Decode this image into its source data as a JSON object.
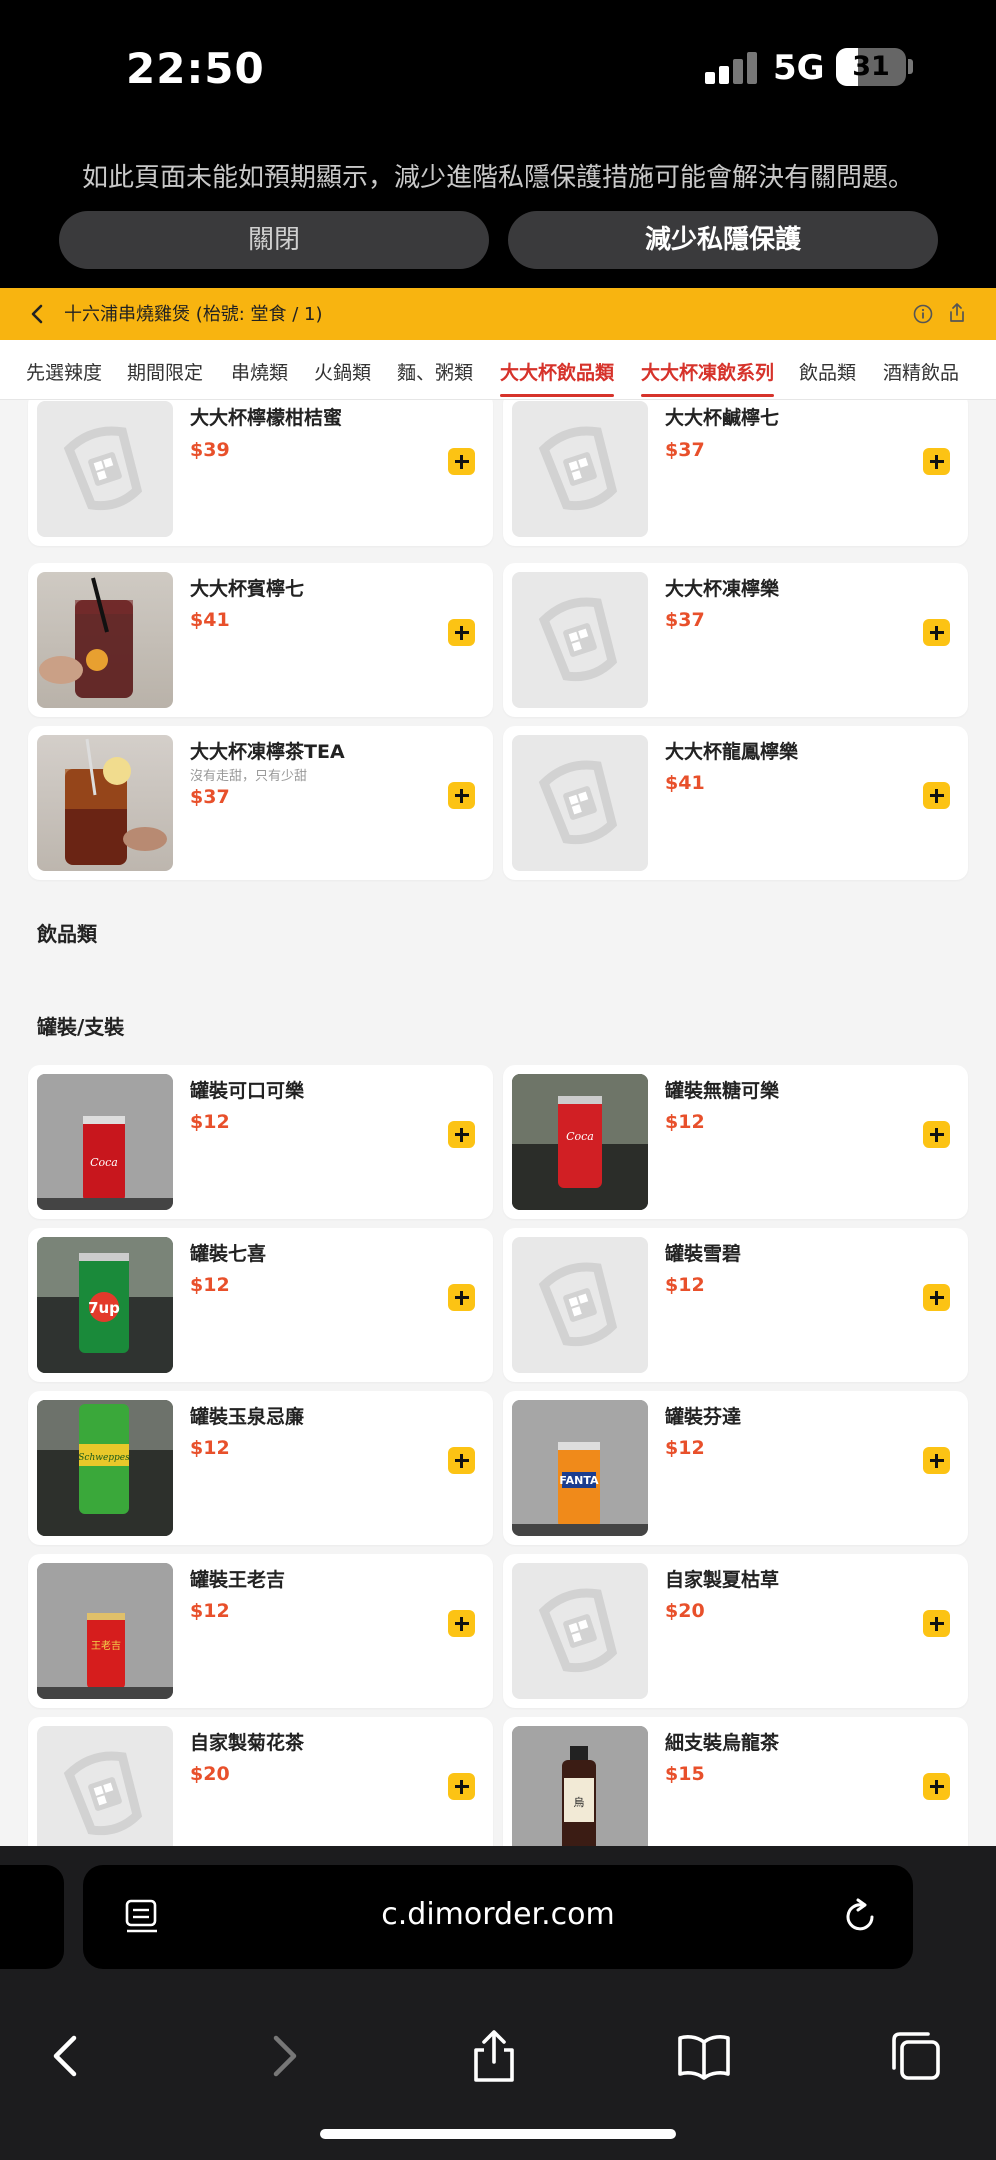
{
  "status_bar": {
    "time": "22:50",
    "network": "5G",
    "battery": "31"
  },
  "privacy_banner": {
    "message": "如此頁面未能如預期顯示，減少進階私隱保護措施可能會解決有關問題。",
    "close_label": "關閉",
    "reduce_label": "減少私隱保護"
  },
  "shop": {
    "title": "十六浦串燒雞煲 (枱號: 堂食 / 1)"
  },
  "tabs": [
    {
      "label": "先選辣度",
      "active": false
    },
    {
      "label": "期間限定",
      "active": false
    },
    {
      "label": "串燒類",
      "active": false
    },
    {
      "label": "火鍋類",
      "active": false
    },
    {
      "label": "麵、粥類",
      "active": false
    },
    {
      "label": "大大杯飲品類",
      "active": true
    },
    {
      "label": "大大杯凍飲系列",
      "active": true
    },
    {
      "label": "飲品類",
      "active": false
    },
    {
      "label": "酒精飲品",
      "active": false
    }
  ],
  "section_drinks": "飲品類",
  "section_cans": "罐裝/支裝",
  "items": [
    {
      "name": "大大杯檸檬柑桔蜜",
      "price": "$39",
      "desc": "",
      "image": "placeholder"
    },
    {
      "name": "大大杯鹹檸七",
      "price": "$37",
      "desc": "",
      "image": "placeholder"
    },
    {
      "name": "大大杯賓檸七",
      "price": "$41",
      "desc": "",
      "image": "red-tea-glass"
    },
    {
      "name": "大大杯凍檸樂",
      "price": "$37",
      "desc": "",
      "image": "placeholder"
    },
    {
      "name": "大大杯凍檸茶TEA",
      "price": "$37",
      "desc": "沒有走甜，只有少甜",
      "image": "lemon-tea-glass"
    },
    {
      "name": "大大杯龍鳳檸樂",
      "price": "$41",
      "desc": "",
      "image": "placeholder"
    },
    {
      "name": "罐裝可口可樂",
      "price": "$12",
      "desc": "",
      "image": "coke-can"
    },
    {
      "name": "罐裝無糖可樂",
      "price": "$12",
      "desc": "",
      "image": "coke-zero-can"
    },
    {
      "name": "罐裝七喜",
      "price": "$12",
      "desc": "",
      "image": "7up-can"
    },
    {
      "name": "罐裝雪碧",
      "price": "$12",
      "desc": "",
      "image": "placeholder"
    },
    {
      "name": "罐裝玉泉忌廉",
      "price": "$12",
      "desc": "",
      "image": "cream-soda-can"
    },
    {
      "name": "罐裝芬達",
      "price": "$12",
      "desc": "",
      "image": "fanta-can"
    },
    {
      "name": "罐裝王老吉",
      "price": "$12",
      "desc": "",
      "image": "wanglaoji-can"
    },
    {
      "name": "自家製夏枯草",
      "price": "$20",
      "desc": "",
      "image": "placeholder"
    },
    {
      "name": "自家製菊花茶",
      "price": "$20",
      "desc": "",
      "image": "placeholder"
    },
    {
      "name": "細支裝烏龍茶",
      "price": "$15",
      "desc": "",
      "image": "oolong-bottle"
    }
  ],
  "browser": {
    "url": "c.dimorder.com"
  },
  "colors": {
    "accent": "#f8b410",
    "active_tab": "#d6332b",
    "price": "#e8502b",
    "add_button": "#fcc314"
  }
}
